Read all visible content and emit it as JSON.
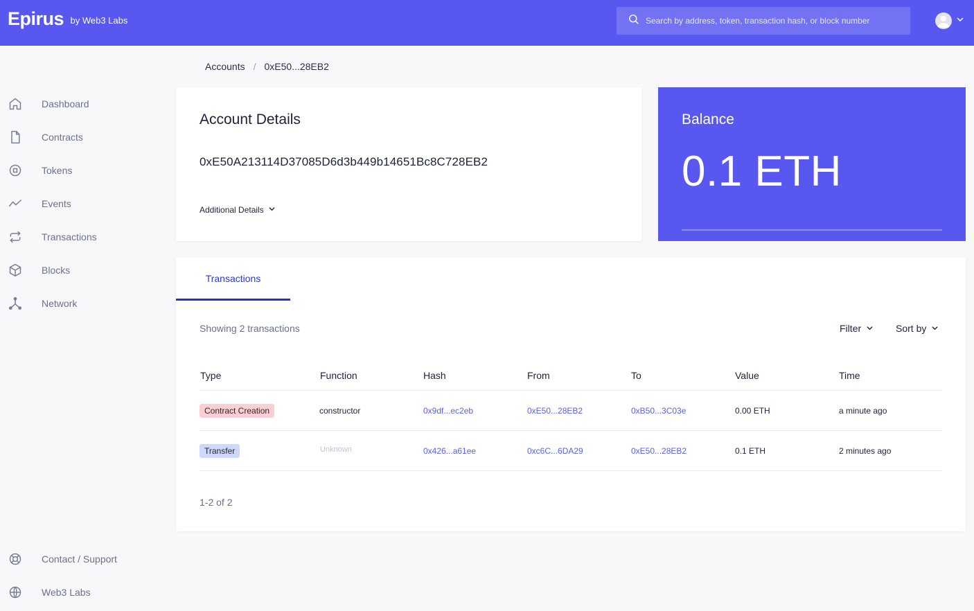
{
  "header": {
    "brand": "Epirus",
    "brand_sub": "by Web3 Labs",
    "search_placeholder": "Search by address, token, transaction hash, or block number"
  },
  "sidebar": {
    "items": [
      {
        "label": "Dashboard",
        "icon": "home-icon"
      },
      {
        "label": "Contracts",
        "icon": "file-icon"
      },
      {
        "label": "Tokens",
        "icon": "token-icon"
      },
      {
        "label": "Events",
        "icon": "activity-icon"
      },
      {
        "label": "Transactions",
        "icon": "repeat-icon"
      },
      {
        "label": "Blocks",
        "icon": "cube-icon"
      },
      {
        "label": "Network",
        "icon": "network-icon"
      }
    ],
    "bottom": [
      {
        "label": "Contact / Support",
        "icon": "lifebuoy-icon"
      },
      {
        "label": "Web3 Labs",
        "icon": "globe-icon"
      }
    ]
  },
  "breadcrumb": {
    "root": "Accounts",
    "separator": "/",
    "current": "0xE50...28EB2"
  },
  "account": {
    "title": "Account Details",
    "address": "0xE50A213114D37085D6d3b449b14651Bc8C728EB2",
    "additional_label": "Additional Details"
  },
  "balance": {
    "title": "Balance",
    "value": "0.1 ETH"
  },
  "transactions": {
    "tab_label": "Transactions",
    "showing": "Showing 2 transactions",
    "filter_label": "Filter",
    "sort_label": "Sort by",
    "columns": [
      "Type",
      "Function",
      "Hash",
      "From",
      "To",
      "Value",
      "Time"
    ],
    "rows": [
      {
        "type": "Contract Creation",
        "type_style": "red",
        "function": "constructor",
        "hash": "0x9df...ec2eb",
        "from": "0xE50...28EB2",
        "to": "0xB50...3C03e",
        "value": "0.00 ETH",
        "time": "a minute ago"
      },
      {
        "type": "Transfer",
        "type_style": "blue",
        "function": "Unknown",
        "hash": "0x426...a61ee",
        "from": "0xc6C...6DA29",
        "to": "0xE50...28EB2",
        "value": "0.1 ETH",
        "time": "2 minutes ago"
      }
    ],
    "pagination": "1-2 of 2"
  },
  "colors": {
    "brand": "#5858f0",
    "link": "#5a5ee8",
    "tab_accent": "#2236c9"
  }
}
